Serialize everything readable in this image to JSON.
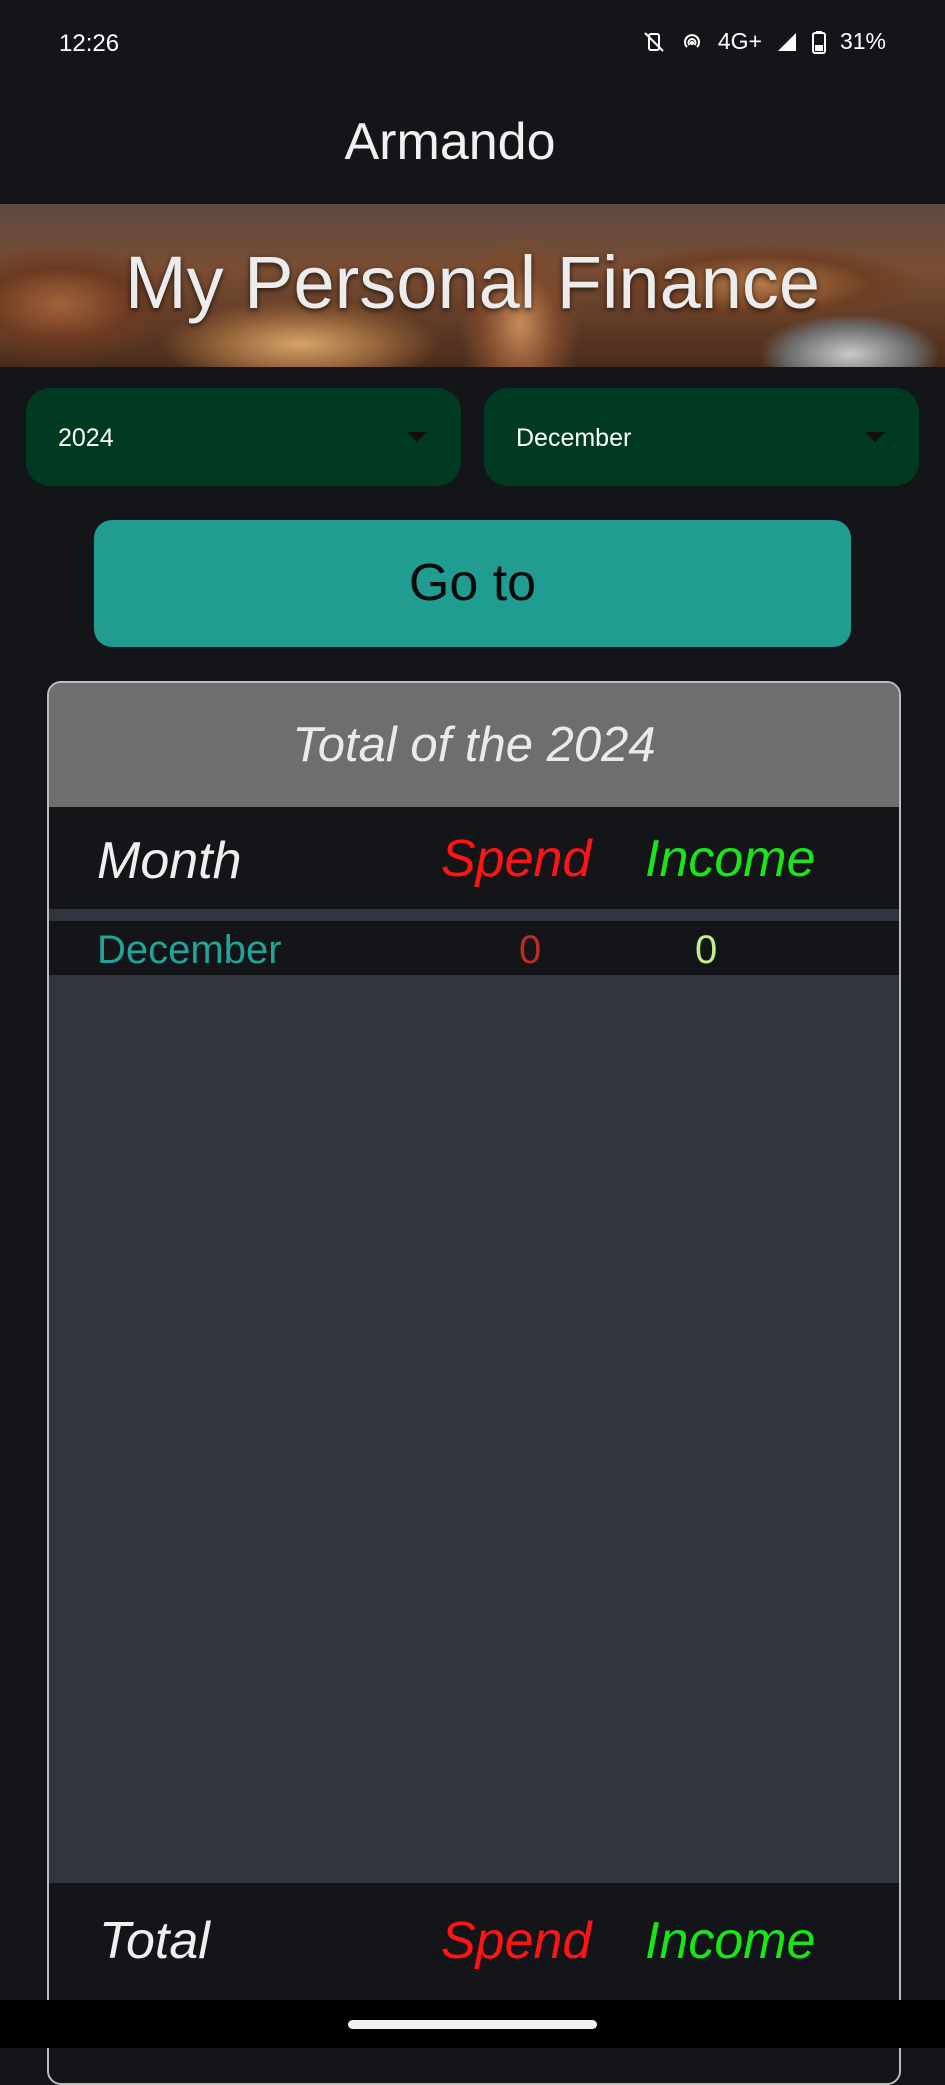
{
  "status_bar": {
    "time": "12:26",
    "network": "4G+",
    "battery": "31%",
    "icons": [
      "mute-vibrate-icon",
      "hotspot-icon",
      "signal-icon",
      "battery-icon"
    ]
  },
  "app": {
    "title": "Armando",
    "banner_title": "My Personal Finance"
  },
  "filters": {
    "year_value": "2024",
    "month_value": "December"
  },
  "goto_label": "Go to",
  "table": {
    "header_title": "Total of the 2024",
    "columns": {
      "month": "Month",
      "spend": "Spend",
      "income": "Income"
    },
    "rows": [
      {
        "month": "December",
        "spend": "0",
        "income": "0"
      }
    ],
    "footer": {
      "label": "Total",
      "spend": "Spend",
      "income": "Income"
    }
  },
  "colors": {
    "accent": "#219c90",
    "select_bg": "#003a22",
    "spend": "#ff1414",
    "income": "#19e619"
  }
}
